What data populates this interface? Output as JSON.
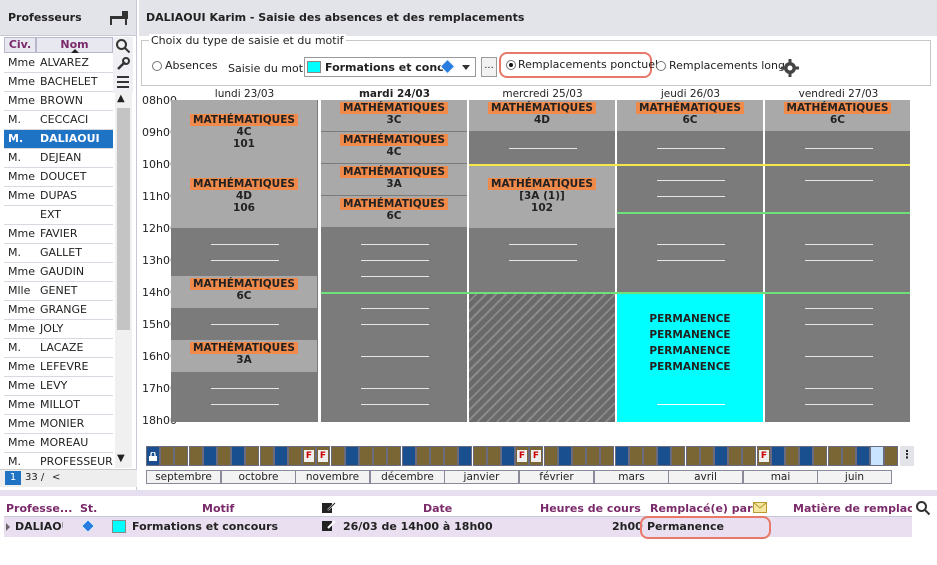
{
  "left_panel": {
    "title": "Professeurs",
    "col_civ": "Civ.",
    "col_nom": "Nom",
    "rows": [
      {
        "civ": "Mme",
        "nom": "ALVAREZ"
      },
      {
        "civ": "Mme",
        "nom": "BACHELET"
      },
      {
        "civ": "Mme",
        "nom": "BROWN"
      },
      {
        "civ": "M.",
        "nom": "CECCACI"
      },
      {
        "civ": "M.",
        "nom": "DALIAOUI"
      },
      {
        "civ": "M.",
        "nom": "DEJEAN"
      },
      {
        "civ": "Mme",
        "nom": "DOUCET"
      },
      {
        "civ": "Mme",
        "nom": "DUPAS"
      },
      {
        "civ": "",
        "nom": "EXT"
      },
      {
        "civ": "Mme",
        "nom": "FAVIER"
      },
      {
        "civ": "M.",
        "nom": "GALLET"
      },
      {
        "civ": "Mme",
        "nom": "GAUDIN"
      },
      {
        "civ": "Mlle",
        "nom": "GENET"
      },
      {
        "civ": "Mme",
        "nom": "GRANGE"
      },
      {
        "civ": "Mme",
        "nom": "JOLY"
      },
      {
        "civ": "M.",
        "nom": "LACAZE"
      },
      {
        "civ": "Mme",
        "nom": "LEFEVRE"
      },
      {
        "civ": "Mme",
        "nom": "LEVY"
      },
      {
        "civ": "Mme",
        "nom": "MILLOT"
      },
      {
        "civ": "Mme",
        "nom": "MONIER"
      },
      {
        "civ": "Mme",
        "nom": "MOREAU"
      },
      {
        "civ": "M.",
        "nom": "PROFESSEUR"
      }
    ],
    "pager_page": "1",
    "pager_total": "33 /"
  },
  "header": {
    "title": "DALIAOUI Karim - Saisie des absences et des remplacements"
  },
  "choice": {
    "legend": "Choix du type de saisie et du motif",
    "absences": "Absences",
    "motif_label": "Saisie du motif",
    "motif_value": "Formations et conco",
    "more": "...",
    "ponctuels": "Remplacements ponctuels",
    "longs": "Remplacements longs"
  },
  "hours": [
    "08h00",
    "09h00",
    "10h00",
    "11h00",
    "12h00",
    "13h00",
    "14h00",
    "15h00",
    "16h00",
    "17h00",
    "18h00"
  ],
  "days": [
    "lundi 23/03",
    "mardi 24/03",
    "mercredi 25/03",
    "jeudi 26/03",
    "vendredi 27/03"
  ],
  "lessons": {
    "l1": {
      "subject": "MATHÉMATIQUES",
      "l2": "4C",
      "l3": "101"
    },
    "l2": {
      "subject": "MATHÉMATIQUES",
      "l2": "4D",
      "l3": "106"
    },
    "l3": {
      "subject": "MATHÉMATIQUES",
      "l2": "6C"
    },
    "l4": {
      "subject": "MATHÉMATIQUES",
      "l2": "3A"
    },
    "m1": {
      "subject": "MATHÉMATIQUES",
      "l2": "3C"
    },
    "m2": {
      "subject": "MATHÉMATIQUES",
      "l2": "4C"
    },
    "m3": {
      "subject": "MATHÉMATIQUES",
      "l2": "3A"
    },
    "m4": {
      "subject": "MATHÉMATIQUES",
      "l2": "6C"
    },
    "w1": {
      "subject": "MATHÉMATIQUES",
      "l2": "4D"
    },
    "w2": {
      "subject": "MATHÉMATIQUES",
      "l2": "[3A (1)]",
      "l3": "102"
    },
    "j1": {
      "subject": "MATHÉMATIQUES",
      "l2": "6C"
    },
    "v1": {
      "subject": "MATHÉMATIQUES",
      "l2": "6C"
    },
    "perm": [
      "PERMANENCE",
      "PERMANENCE",
      "PERMANENCE",
      "PERMANENCE"
    ]
  },
  "timeline": {
    "months": [
      "septembre",
      "octobre",
      "novembre",
      "décembre",
      "janvier",
      "février",
      "mars",
      "avril",
      "mai",
      "juin"
    ],
    "flag": "F"
  },
  "table": {
    "headers": {
      "prof": "Professe...",
      "st": "St.",
      "motif": "Motif",
      "date": "Date",
      "heures": "Heures de cours",
      "remplace": "Remplacé(e) par",
      "matiere": "Matière de remplacer"
    },
    "row": {
      "prof": "DALIAOUI",
      "motif": "Formations et concours",
      "date": "26/03 de 14h00 à 18h00",
      "heures": "2h00",
      "remplace": "Permanence"
    }
  },
  "colors": {
    "accent": "#1f73c4",
    "tag": "#f08a4b",
    "cyan": "#00ffff",
    "highlight": "#e8786a"
  }
}
